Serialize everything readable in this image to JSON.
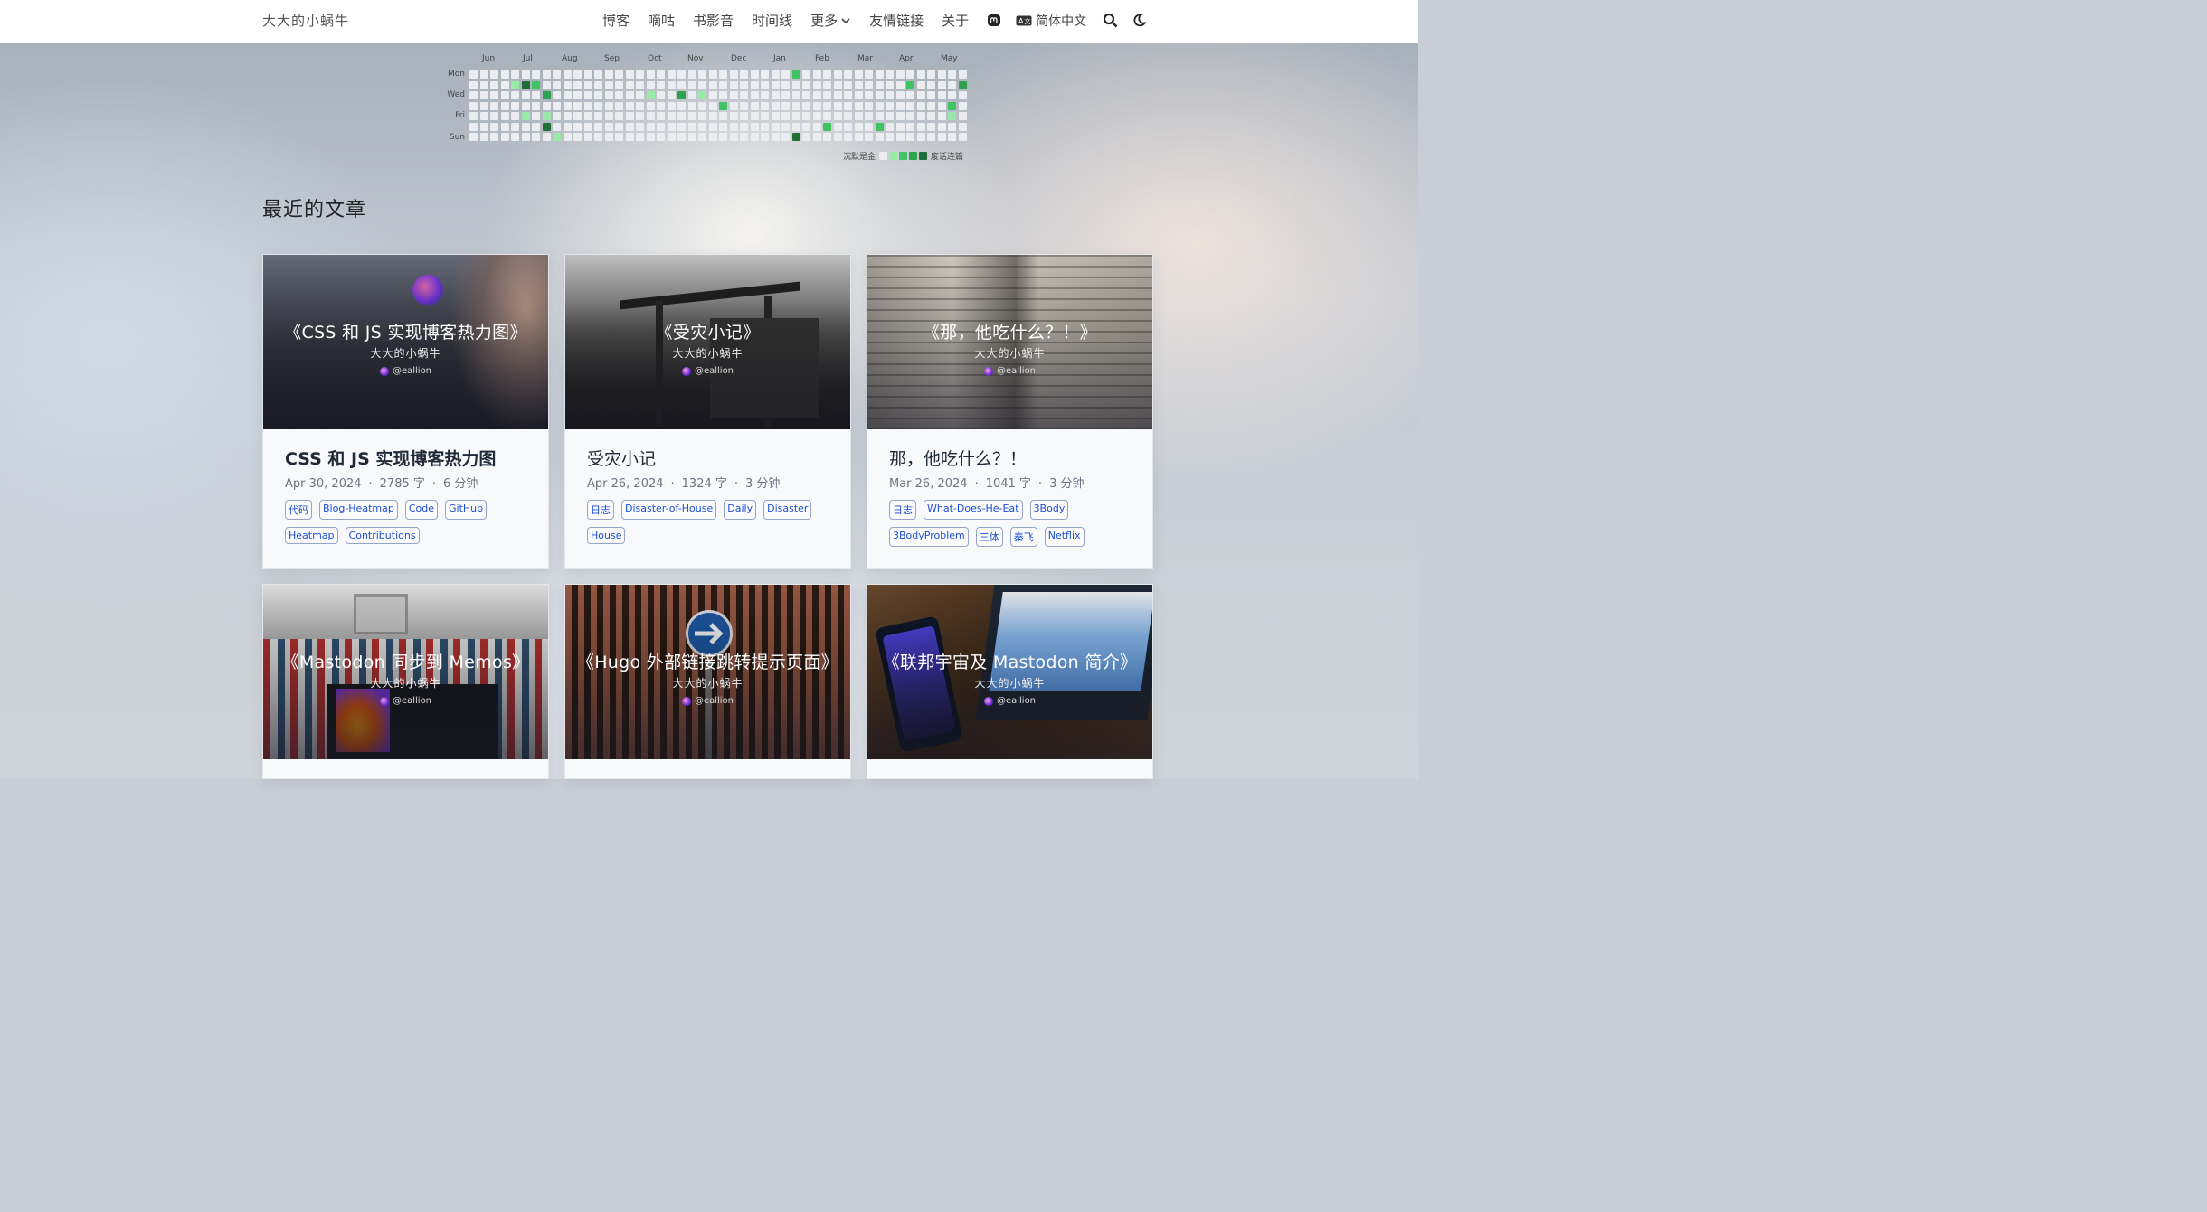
{
  "site": {
    "title": "大大的小蜗牛"
  },
  "nav": {
    "items": [
      "博客",
      "嘀咕",
      "书影音",
      "时间线",
      "更多",
      "友情链接",
      "关于"
    ],
    "language": "简体中文"
  },
  "heatmap": {
    "months": [
      "Jun",
      "Jul",
      "Aug",
      "Sep",
      "Oct",
      "Nov",
      "Dec",
      "Jan",
      "Feb",
      "Mar",
      "Apr",
      "May"
    ],
    "day_labels": [
      "Mon",
      "Wed",
      "Fri",
      "Sun"
    ],
    "legend_left": "沉默是金",
    "legend_right": "废话连篇",
    "colors": [
      "#ebedf0",
      "#9be9a8",
      "#40c463",
      "#30a14e",
      "#216e39"
    ],
    "weeks": 48,
    "active_cells": [
      {
        "week": 4,
        "day": 1,
        "level": 1
      },
      {
        "week": 5,
        "day": 1,
        "level": 4
      },
      {
        "week": 6,
        "day": 1,
        "level": 2
      },
      {
        "week": 7,
        "day": 2,
        "level": 3
      },
      {
        "week": 5,
        "day": 4,
        "level": 1
      },
      {
        "week": 7,
        "day": 4,
        "level": 1
      },
      {
        "week": 7,
        "day": 5,
        "level": 4
      },
      {
        "week": 8,
        "day": 6,
        "level": 1
      },
      {
        "week": 17,
        "day": 2,
        "level": 1
      },
      {
        "week": 20,
        "day": 2,
        "level": 3
      },
      {
        "week": 22,
        "day": 2,
        "level": 1
      },
      {
        "week": 24,
        "day": 3,
        "level": 2
      },
      {
        "week": 31,
        "day": 0,
        "level": 2
      },
      {
        "week": 31,
        "day": 6,
        "level": 4
      },
      {
        "week": 34,
        "day": 5,
        "level": 2
      },
      {
        "week": 39,
        "day": 5,
        "level": 2
      },
      {
        "week": 42,
        "day": 1,
        "level": 2
      },
      {
        "week": 46,
        "day": 3,
        "level": 2
      },
      {
        "week": 46,
        "day": 4,
        "level": 1
      },
      {
        "week": 47,
        "day": 1,
        "level": 3
      }
    ]
  },
  "section": {
    "title": "最近的文章"
  },
  "posts": [
    {
      "cover_title": "《CSS 和 JS 实现博客热力图》",
      "cover_author": "大大的小蜗牛",
      "cover_handle": "@eallion",
      "title": "CSS 和 JS 实现博客热力图",
      "date": "Apr 30, 2024",
      "words": "2785 字",
      "read": "6 分钟",
      "tags": [
        "代码",
        "Blog-Heatmap",
        "Code",
        "GitHub",
        "Heatmap",
        "Contributions"
      ]
    },
    {
      "cover_title": "《受灾小记》",
      "cover_author": "大大的小蜗牛",
      "cover_handle": "@eallion",
      "title": "受灾小记",
      "date": "Apr 26, 2024",
      "words": "1324 字",
      "read": "3 分钟",
      "tags": [
        "日志",
        "Disaster-of-House",
        "Daily",
        "Disaster",
        "House"
      ]
    },
    {
      "cover_title": "《那，他吃什么？！》",
      "cover_author": "大大的小蜗牛",
      "cover_handle": "@eallion",
      "title": "那，他吃什么？！",
      "date": "Mar 26, 2024",
      "words": "1041 字",
      "read": "3 分钟",
      "tags": [
        "日志",
        "What-Does-He-Eat",
        "3Body",
        "3BodyProblem",
        "三体",
        "秦飞",
        "Netflix"
      ]
    },
    {
      "cover_title": "《Mastodon 同步到 Memos》",
      "cover_author": "大大的小蜗牛",
      "cover_handle": "@eallion"
    },
    {
      "cover_title": "《Hugo 外部链接跳转提示页面》",
      "cover_author": "大大的小蜗牛",
      "cover_handle": "@eallion"
    },
    {
      "cover_title": "《联邦宇宙及 Mastodon 简介》",
      "cover_author": "大大的小蜗牛",
      "cover_handle": "@eallion"
    }
  ]
}
